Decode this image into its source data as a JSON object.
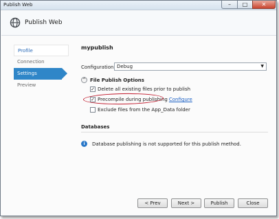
{
  "window": {
    "title": "Publish Web",
    "minimize_glyph": "–",
    "maximize_glyph": "□",
    "close_glyph": "✕"
  },
  "header": {
    "title": "Publish Web",
    "icon": "globe-icon"
  },
  "nav": {
    "items": [
      {
        "label": "Profile",
        "state": "visited"
      },
      {
        "label": "Connection",
        "state": "normal"
      },
      {
        "label": "Settings",
        "state": "selected"
      },
      {
        "label": "Preview",
        "state": "normal"
      }
    ]
  },
  "settings": {
    "profile_name": "mypublish",
    "configuration_label": "Configuration:",
    "configuration_value": "Debug",
    "file_publish": {
      "title": "File Publish Options",
      "collapse_glyph": "^",
      "options": [
        {
          "label": "Delete all existing files prior to publish",
          "checked": true
        },
        {
          "label": "Precompile during publishing",
          "checked": true,
          "link": "Configure"
        },
        {
          "label": "Exclude files from the App_Data folder",
          "checked": false
        }
      ]
    },
    "databases": {
      "title": "Databases",
      "info_text": "Database publishing is not supported for this publish method."
    }
  },
  "buttons": {
    "prev": "< Prev",
    "next": "Next >",
    "publish": "Publish",
    "close": "Close"
  },
  "colors": {
    "accent": "#2f86c8",
    "highlight_ring": "#c0182b",
    "link": "#1a5fc4"
  }
}
